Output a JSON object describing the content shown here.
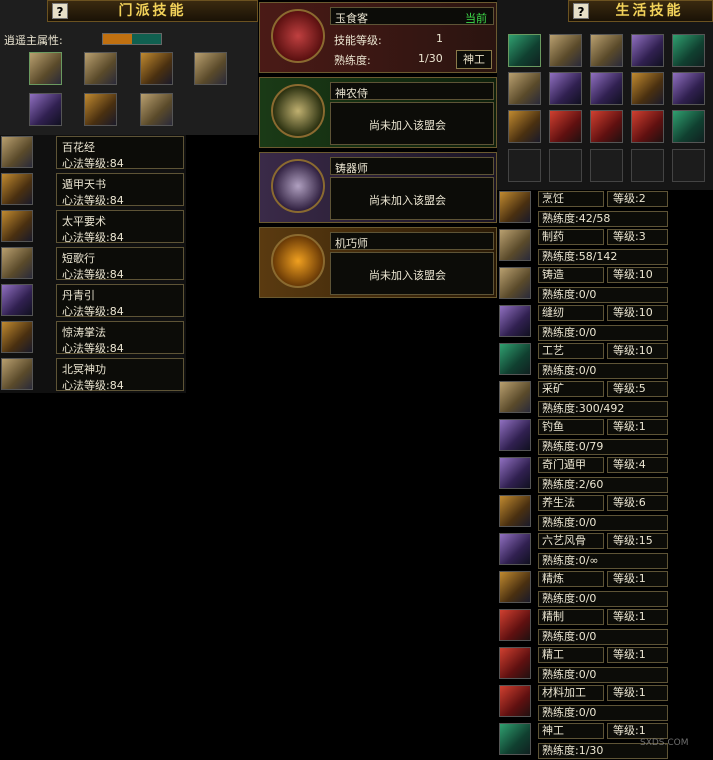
{
  "left": {
    "title": "门派技能",
    "help_label": "?",
    "attr_label": "逍遥主属性:",
    "skills": [
      {
        "name": "百花经",
        "level": "心法等级:84"
      },
      {
        "name": "遁甲天书",
        "level": "心法等级:84"
      },
      {
        "name": "太平要术",
        "level": "心法等级:84"
      },
      {
        "name": "短歌行",
        "level": "心法等级:84"
      },
      {
        "name": "丹青引",
        "level": "心法等级:84"
      },
      {
        "name": "惊涛掌法",
        "level": "心法等级:84"
      },
      {
        "name": "北冥神功",
        "level": "心法等级:84"
      }
    ]
  },
  "middle": {
    "profs": [
      {
        "name": "玉食客",
        "status": "当前",
        "skill_label": "技能等级:",
        "skill_value": "1",
        "prof_label": "熟练度:",
        "prof_value": "1/30",
        "button": "神工"
      },
      {
        "name": "神农侍",
        "message": "尚未加入该盟会"
      },
      {
        "name": "铸器师",
        "message": "尚未加入该盟会"
      },
      {
        "name": "机巧师",
        "message": "尚未加入该盟会"
      }
    ]
  },
  "right": {
    "title": "生活技能",
    "help_label": "?",
    "skills": [
      {
        "name": "烹饪",
        "level": "等级:2",
        "prof": "熟练度:42/58"
      },
      {
        "name": "制药",
        "level": "等级:3",
        "prof": "熟练度:58/142"
      },
      {
        "name": "铸造",
        "level": "等级:10",
        "prof": "熟练度:0/0"
      },
      {
        "name": "缝纫",
        "level": "等级:10",
        "prof": "熟练度:0/0"
      },
      {
        "name": "工艺",
        "level": "等级:10",
        "prof": "熟练度:0/0"
      },
      {
        "name": "采矿",
        "level": "等级:5",
        "prof": "熟练度:300/492"
      },
      {
        "name": "钓鱼",
        "level": "等级:1",
        "prof": "熟练度:0/79"
      },
      {
        "name": "奇门遁甲",
        "level": "等级:4",
        "prof": "熟练度:2/60"
      },
      {
        "name": "养生法",
        "level": "等级:6",
        "prof": "熟练度:0/0"
      },
      {
        "name": "六艺风骨",
        "level": "等级:15",
        "prof": "熟练度:0/∞"
      },
      {
        "name": "精炼",
        "level": "等级:1",
        "prof": "熟练度:0/0"
      },
      {
        "name": "精制",
        "level": "等级:1",
        "prof": "熟练度:0/0"
      },
      {
        "name": "精工",
        "level": "等级:1",
        "prof": "熟练度:0/0"
      },
      {
        "name": "材料加工",
        "level": "等级:1",
        "prof": "熟练度:0/0"
      },
      {
        "name": "神工",
        "level": "等级:1",
        "prof": "熟练度:1/30"
      }
    ]
  },
  "watermark": {
    "text": "SXDS.COM"
  },
  "colors": {
    "title": "#f2d25a",
    "current": "#3fdc4a"
  }
}
